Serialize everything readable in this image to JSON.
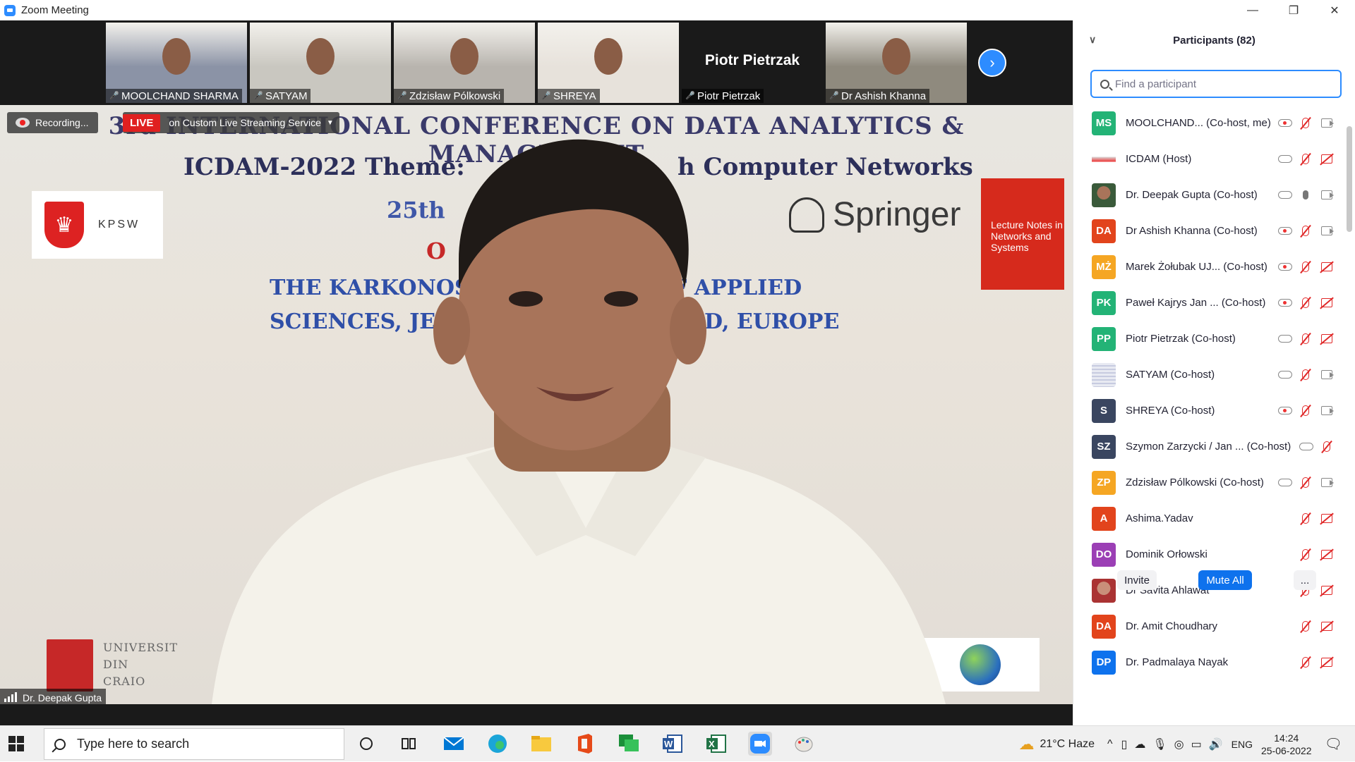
{
  "window": {
    "title": "Zoom Meeting",
    "controls": [
      "minimize",
      "restore",
      "close"
    ]
  },
  "thumbnails": [
    {
      "name": "MOOLCHAND SHARMA",
      "muted": true,
      "bg": "#8b93a6"
    },
    {
      "name": "SATYAM",
      "muted": true,
      "bg": "#c9c7c0"
    },
    {
      "name": "Zdzisław Pólkowski",
      "muted": true,
      "bg": "#b8b4ae"
    },
    {
      "name": "SHREYA",
      "muted": true,
      "bg": "#e7e2db"
    },
    {
      "name": "Piotr Pietrzak",
      "muted": true,
      "bg": "#1a1a1a",
      "video_off": true,
      "display": "Piotr Pietrzak"
    },
    {
      "name": "Dr Ashish Khanna",
      "muted": true,
      "bg": "#8f8a7e"
    }
  ],
  "recording": {
    "label": "Recording..."
  },
  "live": {
    "badge": "LIVE",
    "service": "on Custom Live Streaming Service"
  },
  "slide": {
    "h1": "3rd INTERNATIONAL CONFERENCE ON DATA ANALYTICS & MANAGEMENT",
    "theme_left": "ICDAM-2022 Theme:",
    "theme_right": "h Computer Networks",
    "date": "25th",
    "red": "O",
    "line1_left": "THE KARKONOS",
    "line1_right": "F APPLIED",
    "line2_left": "SCIENCES, JELI",
    "line2_right": "D, EUROPE",
    "kpsw": "KPSW",
    "springer": "Springer",
    "book": "Lecture Notes in Networks and Systems",
    "univ": [
      "UNIVERSIT",
      "DIN",
      "CRAIO"
    ]
  },
  "speaker": {
    "name": "Dr. Deepak Gupta"
  },
  "participants": {
    "title": "Participants (82)",
    "search_placeholder": "Find a participant",
    "rows": [
      {
        "initials": "MS",
        "color": "#23b376",
        "name": "MOOLCHAND...  (Co-host, me)",
        "rec": "red",
        "mic": "off",
        "video": "on"
      },
      {
        "initials": "",
        "color": "#ffffff",
        "image": "icdam",
        "name": "ICDAM (Host)",
        "rec": "gray",
        "mic": "off",
        "video": "off"
      },
      {
        "initials": "",
        "color": "#ffffff",
        "image": "photo",
        "name": "Dr. Deepak Gupta (Co-host)",
        "rec": "gray",
        "mic": "on",
        "video": "on"
      },
      {
        "initials": "DA",
        "color": "#e2441c",
        "name": "Dr Ashish Khanna (Co-host)",
        "rec": "red",
        "mic": "off",
        "video": "on"
      },
      {
        "initials": "MŻ",
        "color": "#f5a623",
        "name": "Marek Żołubak UJ...  (Co-host)",
        "rec": "red",
        "mic": "off",
        "video": "off"
      },
      {
        "initials": "PK",
        "color": "#23b376",
        "name": "Paweł Kajrys Jan ...  (Co-host)",
        "rec": "red",
        "mic": "off",
        "video": "off"
      },
      {
        "initials": "PP",
        "color": "#23b376",
        "name": "Piotr Pietrzak (Co-host)",
        "rec": "gray",
        "mic": "off",
        "video": "off"
      },
      {
        "initials": "",
        "color": "#ffffff",
        "image": "slide",
        "name": "SATYAM (Co-host)",
        "rec": "gray",
        "mic": "off",
        "video": "on"
      },
      {
        "initials": "S",
        "color": "#3a4660",
        "name": "SHREYA (Co-host)",
        "rec": "red",
        "mic": "off",
        "video": "on"
      },
      {
        "initials": "SZ",
        "color": "#3a4660",
        "name": "Szymon Zarzycki / Jan ...  (Co-host)",
        "rec": "gray",
        "mic": "off",
        "video": "none"
      },
      {
        "initials": "ZP",
        "color": "#f5a623",
        "name": "Zdzisław Pólkowski (Co-host)",
        "rec": "gray",
        "mic": "off",
        "video": "on"
      },
      {
        "initials": "A",
        "color": "#e2441c",
        "name": "Ashima.Yadav",
        "rec": "none",
        "mic": "off",
        "video": "off"
      },
      {
        "initials": "DO",
        "color": "#9b3fb5",
        "name": "Dominik Orłowski",
        "rec": "none",
        "mic": "off",
        "video": "off"
      },
      {
        "initials": "",
        "color": "#ffffff",
        "image": "photo2",
        "name": "Dr Savita Ahlawat",
        "rec": "none",
        "mic": "off",
        "video": "off"
      },
      {
        "initials": "DA",
        "color": "#e2441c",
        "name": "Dr. Amit Choudhary",
        "rec": "none",
        "mic": "off",
        "video": "off"
      },
      {
        "initials": "DP",
        "color": "#0e72ed",
        "name": "Dr. Padmalaya Nayak",
        "rec": "none",
        "mic": "off",
        "video": "off"
      }
    ],
    "footer": {
      "invite": "Invite",
      "mute_all": "Mute All",
      "more": "..."
    }
  },
  "taskbar": {
    "search_placeholder": "Type here to search",
    "weather": "21°C  Haze",
    "lang": "ENG",
    "time": "14:24",
    "date": "25-06-2022",
    "apps": [
      "task-view",
      "taskview-icon",
      "mail",
      "edge",
      "explorer",
      "office",
      "teams",
      "word",
      "excel",
      "zoom",
      "paint"
    ]
  }
}
